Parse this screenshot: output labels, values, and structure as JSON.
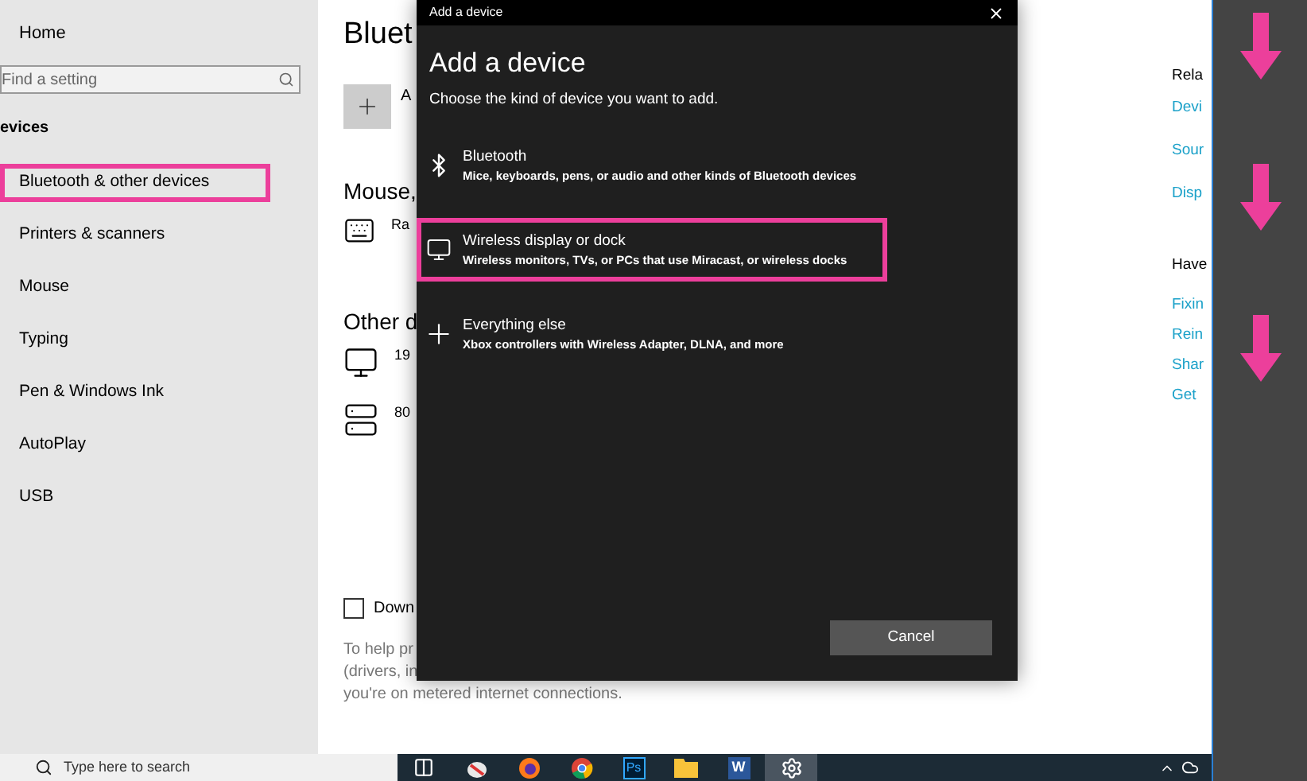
{
  "sidebar": {
    "home": "Home",
    "search": {
      "placeholder": "Find a setting"
    },
    "section": "evices",
    "items": [
      {
        "label": "Bluetooth & other devices",
        "highlighted": true
      },
      {
        "label": "Printers & scanners",
        "highlighted": false
      },
      {
        "label": "Mouse",
        "highlighted": false
      },
      {
        "label": "Typing",
        "highlighted": false
      },
      {
        "label": "Pen & Windows Ink",
        "highlighted": false
      },
      {
        "label": "AutoPlay",
        "highlighted": false
      },
      {
        "label": "USB",
        "highlighted": false
      }
    ]
  },
  "main": {
    "title": "Bluet",
    "add_label": "A",
    "mouse_heading": "Mouse,",
    "mouse_devices": [
      {
        "kind": "keyboard",
        "name": "Ra"
      }
    ],
    "other_heading": "Other d",
    "other_devices": [
      {
        "kind": "monitor",
        "name": "19"
      },
      {
        "kind": "tower",
        "name": "80"
      }
    ],
    "download": {
      "label": "Down",
      "checked": false
    },
    "note_lines": [
      "To help pr",
      "(drivers, in",
      "you're on metered internet connections."
    ]
  },
  "related": {
    "heading": "Rela",
    "links": [
      "Devi",
      "Sour",
      "Disp"
    ],
    "help_heading": "Have",
    "help_links": [
      "Fixin",
      "Rein",
      "Shar",
      "Get"
    ]
  },
  "dialog": {
    "title_bar": "Add a device",
    "heading": "Add a device",
    "subtitle": "Choose the kind of device you want to add.",
    "options": [
      {
        "kind": "bluetooth",
        "title": "Bluetooth",
        "description": "Mice, keyboards, pens, or audio and other kinds of Bluetooth devices",
        "highlighted": false
      },
      {
        "kind": "display",
        "title": "Wireless display or dock",
        "description": "Wireless monitors, TVs, or PCs that use Miracast, or wireless docks",
        "highlighted": true
      },
      {
        "kind": "other",
        "title": "Everything else",
        "description": "Xbox controllers with Wireless Adapter, DLNA, and more",
        "highlighted": false
      }
    ],
    "cancel": "Cancel"
  },
  "taskbar": {
    "search_placeholder": "Type here to search",
    "apps": [
      {
        "kind": "taskview",
        "selected": false
      },
      {
        "kind": "app",
        "selected": false
      },
      {
        "kind": "firefox",
        "selected": false
      },
      {
        "kind": "chrome",
        "selected": false
      },
      {
        "kind": "photoshop",
        "glyph": "Ps",
        "selected": false
      },
      {
        "kind": "folder",
        "selected": false
      },
      {
        "kind": "word",
        "glyph": "W",
        "selected": false
      },
      {
        "kind": "settings",
        "selected": true
      }
    ]
  }
}
